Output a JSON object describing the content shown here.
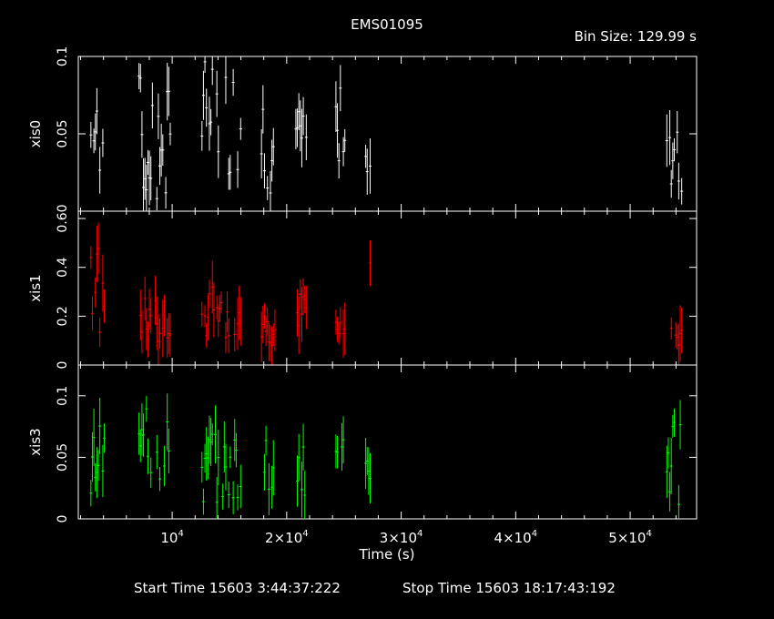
{
  "header": {
    "title": "EMS01095",
    "bin_size": "Bin Size: 129.99 s"
  },
  "footer": {
    "start_time": "Start Time 15603  3:44:37:222",
    "stop_time": "Stop Time 15603 18:17:43:192"
  },
  "chart_data": {
    "type": "scatter",
    "title": "EMS01095",
    "xlabel": "Time (s)",
    "xlim": [
      1800,
      55800
    ],
    "x_ticks": [
      {
        "value": 10000,
        "mantissa": "10",
        "exp": "4"
      },
      {
        "value": 20000,
        "mantissa": "2×10",
        "exp": "4"
      },
      {
        "value": 30000,
        "mantissa": "3×10",
        "exp": "4"
      },
      {
        "value": 40000,
        "mantissa": "4×10",
        "exp": "4"
      },
      {
        "value": 50000,
        "mantissa": "5×10",
        "exp": "4"
      }
    ],
    "panels": [
      {
        "name": "xis0",
        "color": "#ffffff",
        "ylim": [
          0.0,
          0.1
        ],
        "yticks": [
          {
            "value": 0.05,
            "label": "0.05"
          },
          {
            "value": 0.1,
            "label": "0.1"
          }
        ],
        "clusters": [
          [
            2900,
            4100,
            0.01,
            0.08
          ],
          [
            7100,
            9900,
            0.0,
            0.09
          ],
          [
            12600,
            16000,
            0.02,
            0.1
          ],
          [
            17800,
            19000,
            0.01,
            0.07
          ],
          [
            20800,
            21800,
            0.02,
            0.07
          ],
          [
            24300,
            25200,
            0.03,
            0.08
          ],
          [
            26900,
            27400,
            0.02,
            0.05
          ],
          [
            53200,
            54500,
            0.01,
            0.1
          ]
        ]
      },
      {
        "name": "xis1",
        "color": "#ff0000",
        "ylim": [
          0.0,
          0.63
        ],
        "yticks": [
          {
            "value": 0,
            "label": "0"
          },
          {
            "value": 0.2,
            "label": "0.2"
          },
          {
            "value": 0.4,
            "label": "0.4"
          },
          {
            "value": 0.6,
            "label": "0.60"
          }
        ],
        "clusters": [
          [
            2900,
            4100,
            0.1,
            0.5
          ],
          [
            7100,
            9900,
            0.08,
            0.28
          ],
          [
            12600,
            16000,
            0.1,
            0.32
          ],
          [
            17800,
            19000,
            0.08,
            0.22
          ],
          [
            20800,
            21800,
            0.15,
            0.3
          ],
          [
            24300,
            25200,
            0.1,
            0.22
          ],
          [
            26900,
            27400,
            0.2,
            0.45
          ],
          [
            53200,
            54500,
            0.08,
            0.15
          ]
        ]
      },
      {
        "name": "xis3",
        "color": "#00ff00",
        "ylim": [
          0.0,
          0.125
        ],
        "yticks": [
          {
            "value": 0,
            "label": "0"
          },
          {
            "value": 0.05,
            "label": "0.05"
          },
          {
            "value": 0.1,
            "label": "0.1"
          }
        ],
        "clusters": [
          [
            2900,
            4100,
            0.02,
            0.08
          ],
          [
            7100,
            9900,
            0.02,
            0.09
          ],
          [
            12600,
            16000,
            0.01,
            0.07
          ],
          [
            17800,
            19000,
            0.02,
            0.07
          ],
          [
            20800,
            21800,
            0.01,
            0.06
          ],
          [
            24300,
            25200,
            0.02,
            0.08
          ],
          [
            26900,
            27400,
            0.03,
            0.06
          ],
          [
            53200,
            54500,
            0.01,
            0.08
          ]
        ]
      }
    ]
  }
}
